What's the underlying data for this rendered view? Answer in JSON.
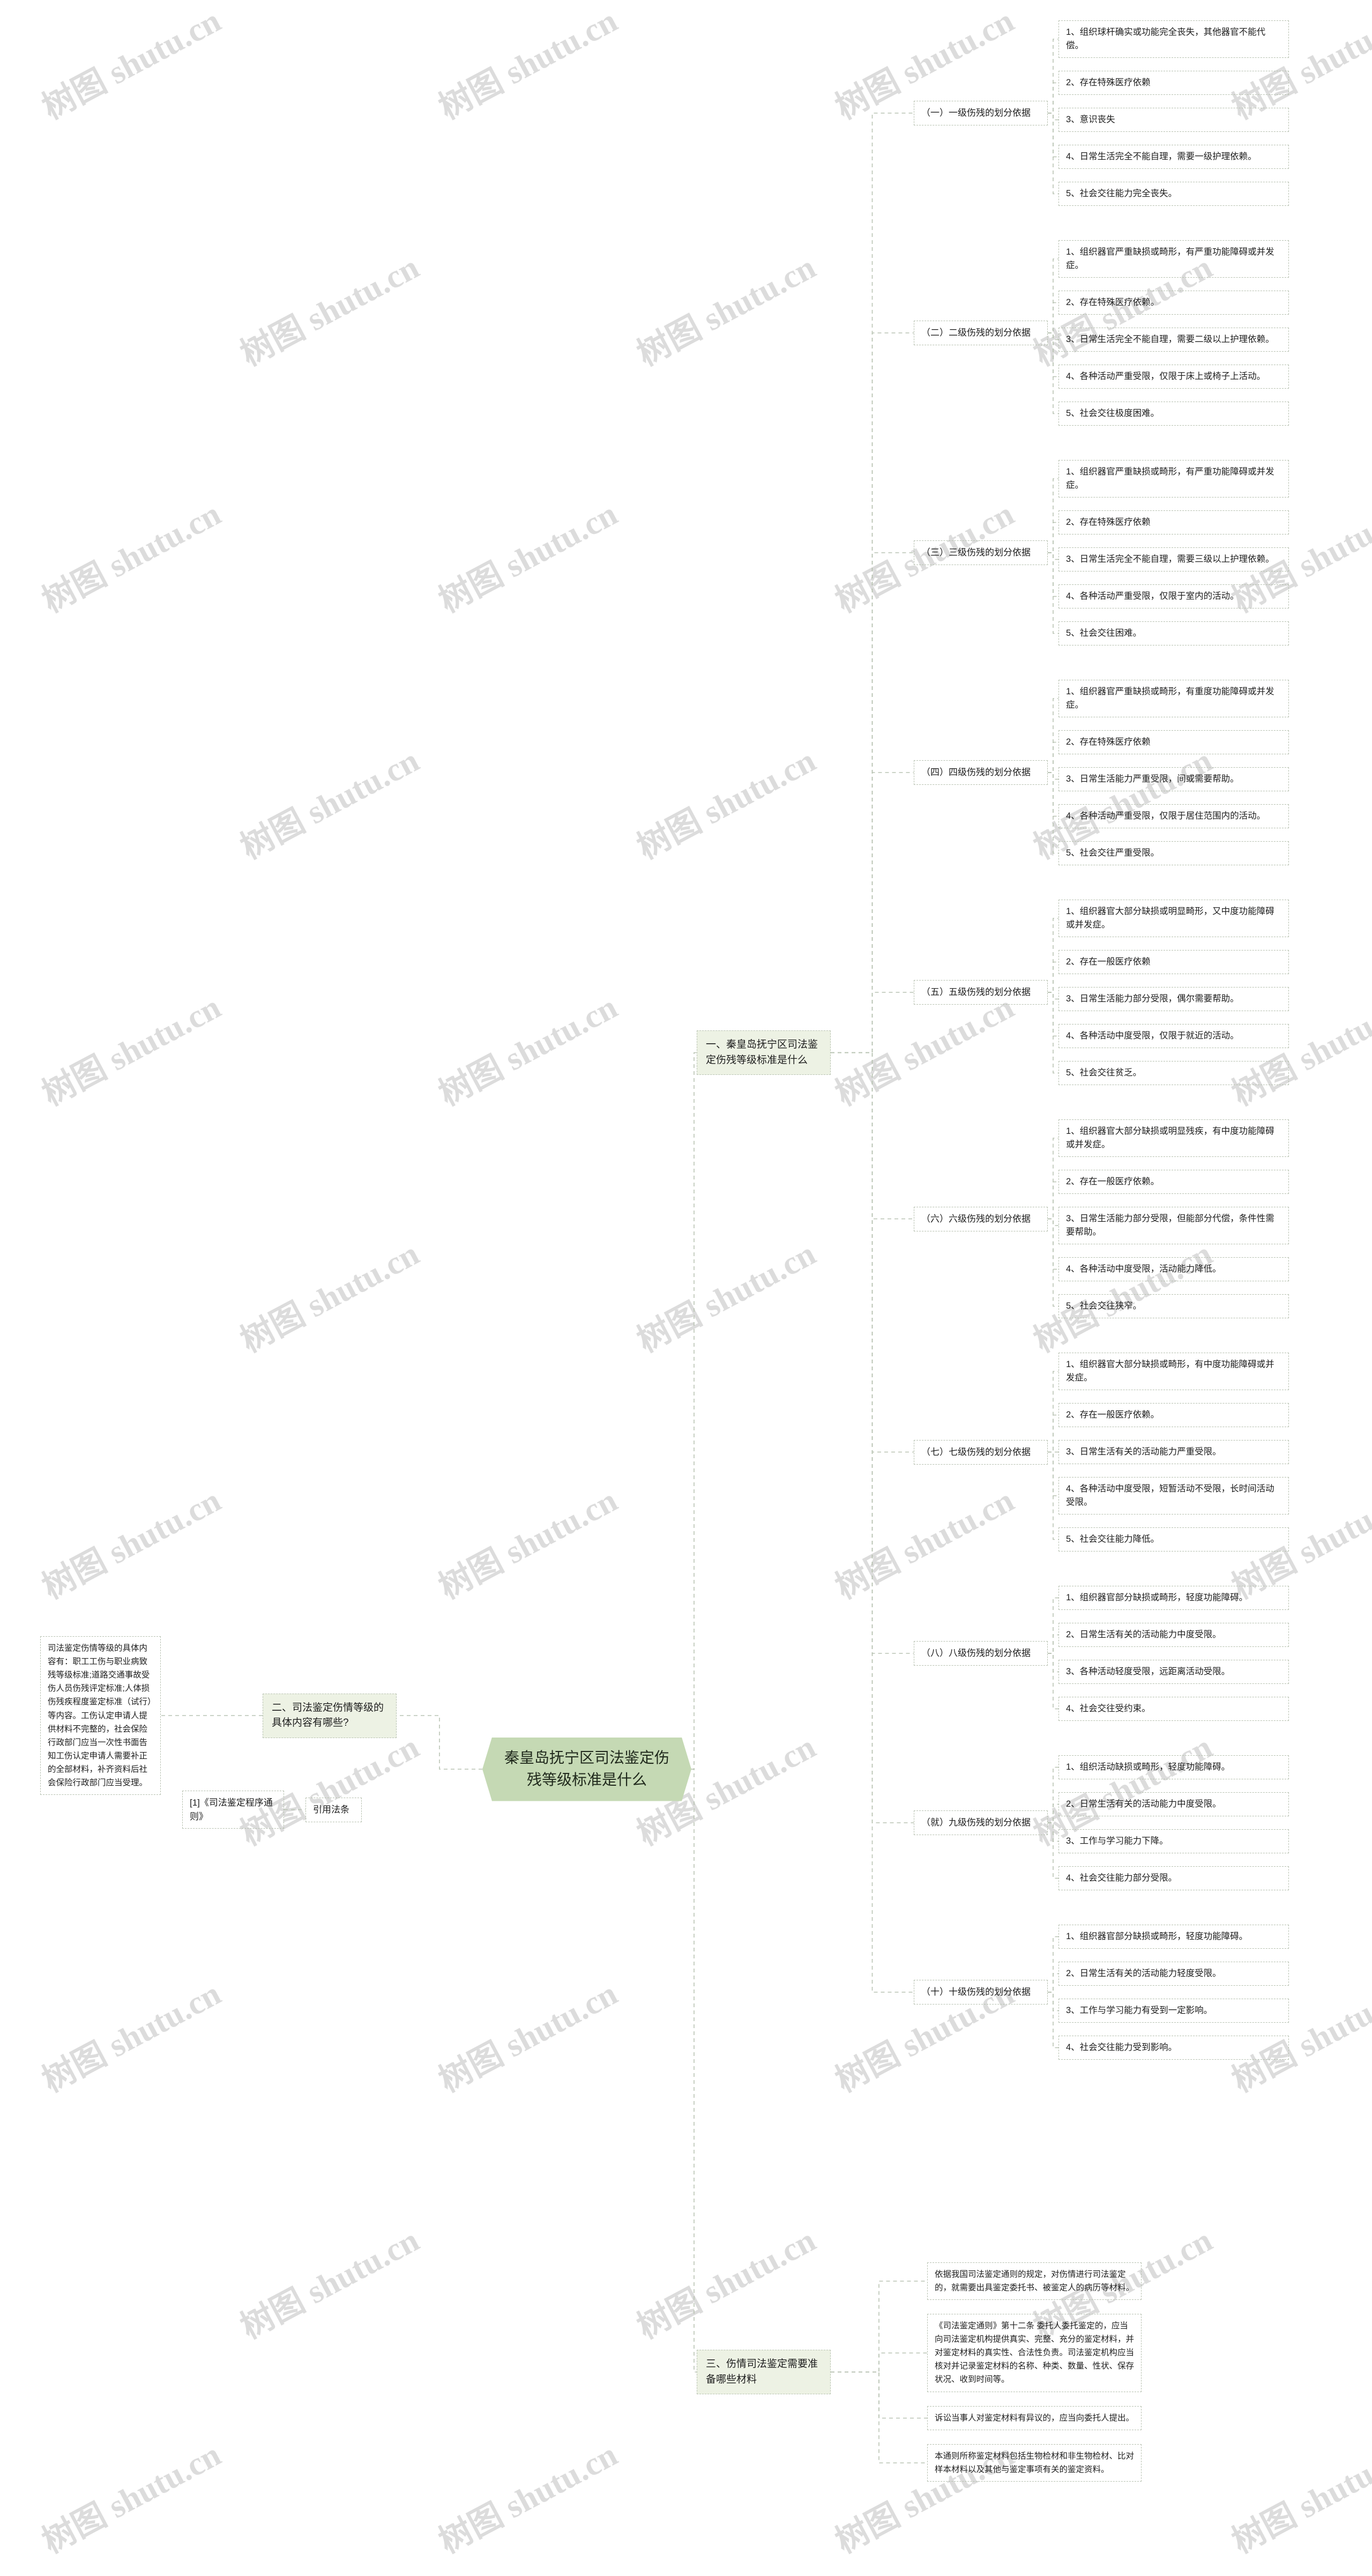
{
  "watermark": {
    "text": "树图 shutu.cn"
  },
  "root": {
    "label": "秦皇岛抚宁区司法鉴定伤残等级标准是什么"
  },
  "branches": {
    "b1": {
      "label": "一、秦皇岛抚宁区司法鉴定伤残等级标准是什么"
    },
    "b2": {
      "label": "二、司法鉴定伤情等级的具体内容有哪些?"
    },
    "b3": {
      "label": "三、伤情司法鉴定需要准备哪些材料"
    }
  },
  "groups": [
    {
      "label": "（一）一级伤残的划分依据",
      "items": [
        "1、组织球杆确实或功能完全丧失，其他器官不能代偿。",
        "2、存在特殊医疗依赖",
        "3、意识丧失",
        "4、日常生活完全不能自理，需要一级护理依赖。",
        "5、社会交往能力完全丧失。"
      ]
    },
    {
      "label": "（二）二级伤残的划分依据",
      "items": [
        "1、组织器官严重缺损或畸形，有严重功能障碍或并发症。",
        "2、存在特殊医疗依赖。",
        "3、日常生活完全不能自理，需要二级以上护理依赖。",
        "4、各种活动严重受限，仅限于床上或椅子上活动。",
        "5、社会交往极度困难。"
      ]
    },
    {
      "label": "（三）三级伤残的划分依据",
      "items": [
        "1、组织器官严重缺损或畸形，有严重功能障碍或并发症。",
        "2、存在特殊医疗依赖",
        "3、日常生活完全不能自理，需要三级以上护理依赖。",
        "4、各种活动严重受限，仅限于室内的活动。",
        "5、社会交往困难。"
      ]
    },
    {
      "label": "（四）四级伤残的划分依据",
      "items": [
        "1、组织器官严重缺损或畸形，有重度功能障碍或并发症。",
        "2、存在特殊医疗依赖",
        "3、日常生活能力严重受限，间或需要帮助。",
        "4、各种活动严重受限，仅限于居住范围内的活动。",
        "5、社会交往严重受限。"
      ]
    },
    {
      "label": "（五）五级伤残的划分依据",
      "items": [
        "1、组织器官大部分缺损或明显畸形，又中度功能障碍或并发症。",
        "2、存在一般医疗依赖",
        "3、日常生活能力部分受限，偶尔需要帮助。",
        "4、各种活动中度受限，仅限于就近的活动。",
        "5、社会交往贫乏。"
      ]
    },
    {
      "label": "（六）六级伤残的划分依据",
      "items": [
        "1、组织器官大部分缺损或明显残疾，有中度功能障碍或并发症。",
        "2、存在一般医疗依赖。",
        "3、日常生活能力部分受限，但能部分代偿，条件性需要帮助。",
        "4、各种活动中度受限，活动能力降低。",
        "5、社会交往狭窄。"
      ]
    },
    {
      "label": "（七）七级伤残的划分依据",
      "items": [
        "1、组织器官大部分缺损或畸形，有中度功能障碍或并发症。",
        "2、存在一般医疗依赖。",
        "3、日常生活有关的活动能力严重受限。",
        "4、各种活动中度受限，短暂活动不受限，长时间活动受限。",
        "5、社会交往能力降低。"
      ]
    },
    {
      "label": "（八）八级伤残的划分依据",
      "items": [
        "1、组织器官部分缺损或畸形，轻度功能障碍。",
        "2、日常生活有关的活动能力中度受限。",
        "3、各种活动轻度受限，远距离活动受限。",
        "4、社会交往受约束。"
      ]
    },
    {
      "label": "（就）九级伤残的划分依据",
      "items": [
        "1、组织活动缺损或畸形，轻度功能障碍。",
        "2、日常生活有关的活动能力中度受限。",
        "3、工作与学习能力下降。",
        "4、社会交往能力部分受限。"
      ]
    },
    {
      "label": "（十）十级伤残的划分依据",
      "items": [
        "1、组织器官部分缺损或畸形，轻度功能障碍。",
        "2、日常生活有关的活动能力轻度受限。",
        "3、工作与学习能力有受到一定影响。",
        "4、社会交往能力受到影响。"
      ]
    }
  ],
  "left_detail": {
    "paragraph": "司法鉴定伤情等级的具体内容有：职工工伤与职业病致残等级标准;道路交通事故受伤人员伤残评定标准;人体损伤残疾程度鉴定标准（试行）等内容。工伤认定申请人提供材料不完整的，社会保险行政部门应当一次性书面告知工伤认定申请人需要补正的全部材料，补齐资料后社会保险行政部门应当受理。",
    "citation": "[1]《司法鉴定程序通则》",
    "citation_label": "引用法条"
  },
  "materials": [
    "依据我国司法鉴定通则的规定，对伤情进行司法鉴定的，就需要出具鉴定委托书、被鉴定人的病历等材料。",
    "《司法鉴定通则》第十二条 委托人委托鉴定的，应当向司法鉴定机构提供真实、完整、充分的鉴定材料，并对鉴定材料的真实性、合法性负责。司法鉴定机构应当核对并记录鉴定材料的名称、种类、数量、性状、保存状况、收到时间等。",
    "诉讼当事人对鉴定材料有异议的，应当向委托人提出。",
    "本通则所称鉴定材料包括生物检材和非生物检材、比对样本材料以及其他与鉴定事项有关的鉴定资料。"
  ]
}
